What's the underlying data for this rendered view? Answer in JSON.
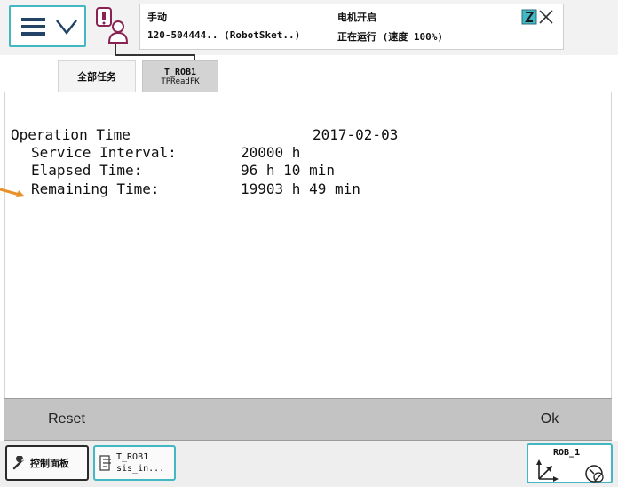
{
  "status": {
    "mode": "手动",
    "system": "120-504444.. (RobotSket..)",
    "motor": "电机开启",
    "run_state": "正在运行 (速度 100%)"
  },
  "tabs": {
    "all_tasks": "全部任务",
    "active_task": "T_ROB1",
    "active_sub": "TPReadFK"
  },
  "content": {
    "operation_time_label": "Operation Time",
    "operation_time_value": "2017-02-03",
    "service_interval_label": "Service Interval:",
    "service_interval_value": "20000 h",
    "elapsed_time_label": "Elapsed Time:",
    "elapsed_time_value": "96 h 10 min",
    "remaining_time_label": "Remaining Time:",
    "remaining_time_value": "19903 h 49 min"
  },
  "commands": {
    "reset": "Reset",
    "ok": "Ok"
  },
  "taskbar": {
    "control_panel": "控制面板",
    "program_line1": "T_ROB1",
    "program_line2": "sis_in...",
    "jog_label": "ROB_1"
  },
  "icons": {
    "menu": "hamburger-menu-icon",
    "menu_chevron": "chevron-down-icon",
    "operator": "operator-window-icon",
    "status": "status-window-icon",
    "close": "close-icon",
    "pointer": "orange-arrow-icon",
    "control_panel": "wrench-icon",
    "program": "program-icon",
    "jog_axes": "coordinate-axes-icon",
    "jog_speed": "speed-icon"
  },
  "colors": {
    "accent": "#43b7c4",
    "menu_bars": "#224466",
    "pointer": "#e8912b",
    "command_bar": "#c3c3c3"
  }
}
